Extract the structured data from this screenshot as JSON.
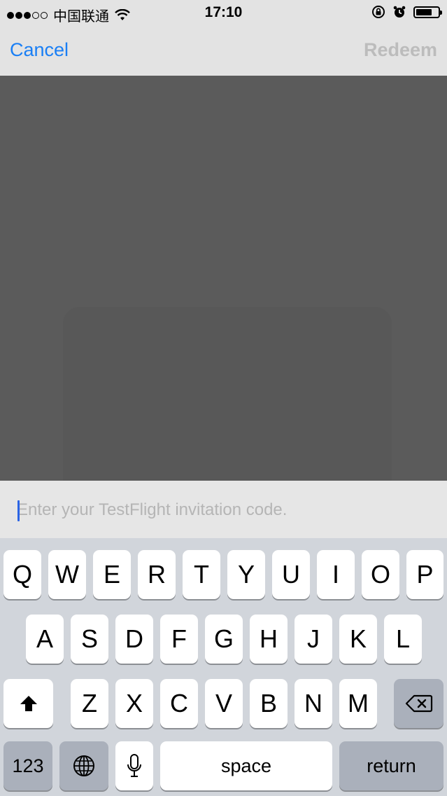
{
  "status_bar": {
    "carrier": "中国联通",
    "time": "17:10",
    "signal_bars_filled": 3,
    "signal_bars_total": 5,
    "battery_level": 0.72,
    "icons": [
      "wifi-icon",
      "orientation-lock-icon",
      "alarm-icon",
      "battery-icon"
    ]
  },
  "nav": {
    "cancel_label": "Cancel",
    "redeem_label": "Redeem"
  },
  "input": {
    "value": "",
    "placeholder": "Enter your TestFlight invitation code."
  },
  "keyboard": {
    "row1": [
      "Q",
      "W",
      "E",
      "R",
      "T",
      "Y",
      "U",
      "I",
      "O",
      "P"
    ],
    "row2": [
      "A",
      "S",
      "D",
      "F",
      "G",
      "H",
      "J",
      "K",
      "L"
    ],
    "row3": [
      "Z",
      "X",
      "C",
      "V",
      "B",
      "N",
      "M"
    ],
    "numbers_label": "123",
    "space_label": "space",
    "return_label": "return",
    "icons": [
      "shift-icon",
      "backspace-icon",
      "globe-icon",
      "microphone-icon"
    ]
  },
  "colors": {
    "accent": "#1a7ff5",
    "disabled": "#bcbcbc",
    "camera_bg": "#5b5b5b",
    "keyboard_bg": "#d1d5db"
  }
}
